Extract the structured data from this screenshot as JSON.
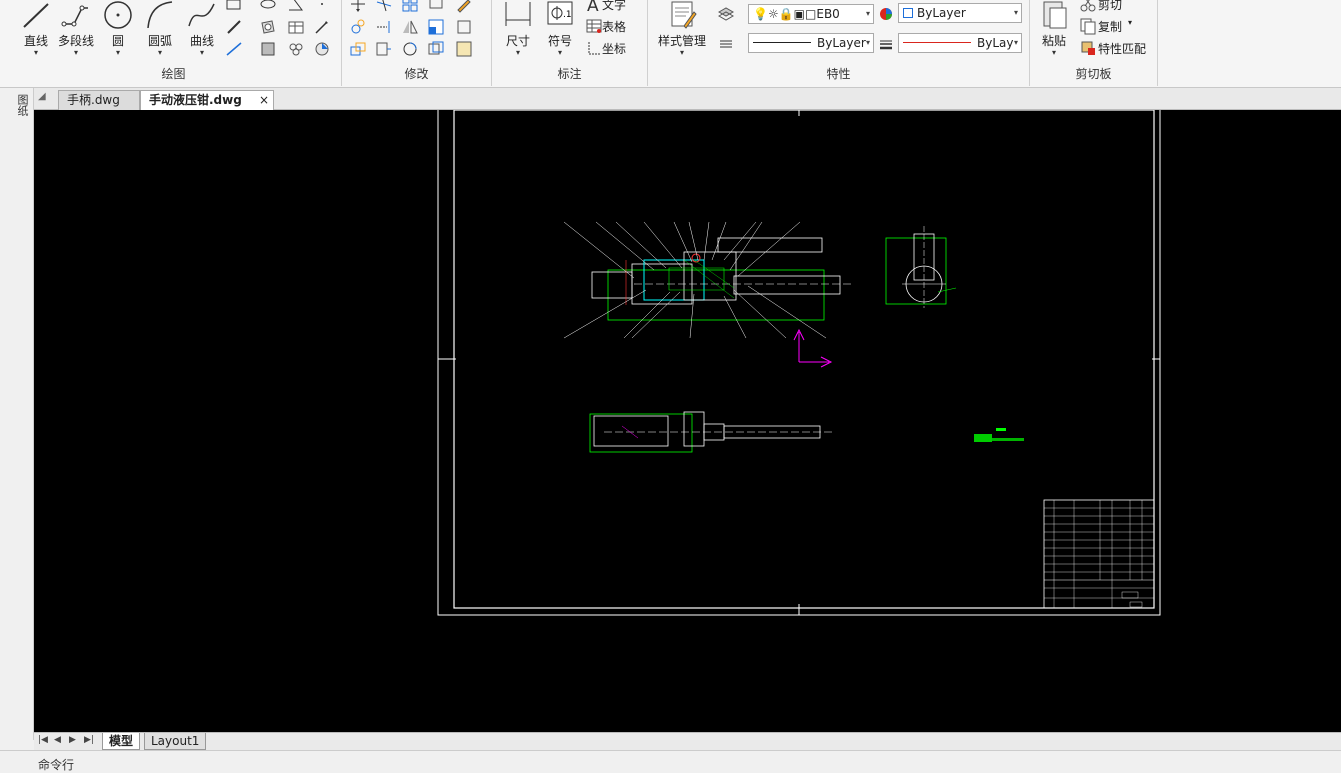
{
  "ribbon": {
    "draw_panel": {
      "title": "绘图",
      "tools": [
        {
          "label": "直线",
          "icon": "line-icon"
        },
        {
          "label": "多段线",
          "icon": "polyline-icon"
        },
        {
          "label": "圆",
          "icon": "circle-icon"
        },
        {
          "label": "圆弧",
          "icon": "arc-icon"
        },
        {
          "label": "曲线",
          "icon": "spline-icon"
        }
      ]
    },
    "modify_panel": {
      "title": "修改"
    },
    "annotate_panel": {
      "title": "标注",
      "dimension_label": "尺寸",
      "symbol_label": "符号",
      "text_label": "文字",
      "table_label": "表格",
      "coordinate_label": "坐标"
    },
    "properties_panel": {
      "title": "特性",
      "style_manager_label": "样式管理",
      "layer_value": "EB0",
      "color_value": "ByLayer",
      "linetype_value": "ByLayer",
      "lineweight_value": "ByLay"
    },
    "clipboard_panel": {
      "title": "剪切板",
      "paste_label": "粘贴",
      "cut_label": "剪切",
      "copy_label": "复制",
      "match_label": "特性匹配"
    }
  },
  "left_strip": {
    "label": "图纸"
  },
  "file_tabs": [
    {
      "label": "手柄.dwg"
    },
    {
      "label": "手动液压钳.dwg"
    }
  ],
  "layout_tabs": [
    {
      "label": "模型"
    },
    {
      "label": "Layout1"
    }
  ],
  "command_line": {
    "label": "命令行"
  },
  "colors": {
    "canvas": "#000000",
    "drawing_green": "#00ff00",
    "ucs_magenta": "#ff00ff",
    "frame_white": "#ffffff"
  }
}
